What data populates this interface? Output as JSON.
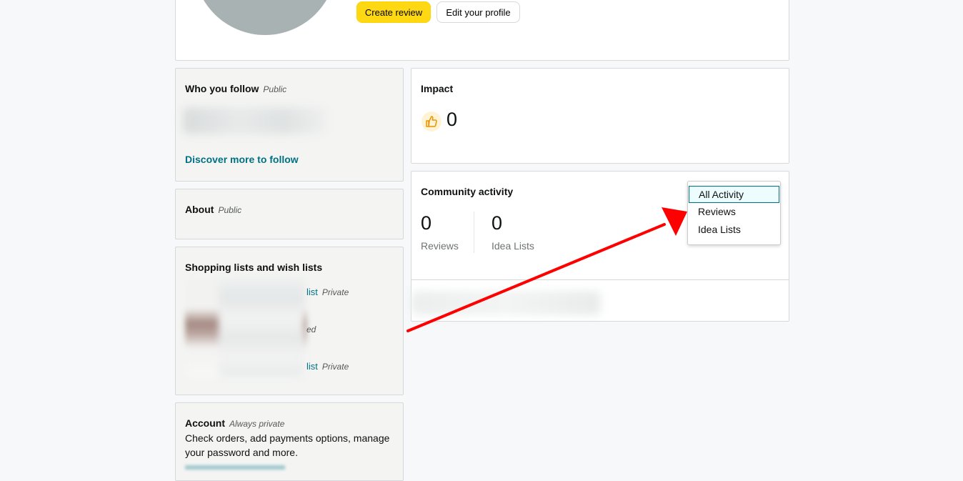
{
  "header": {
    "create_review_label": "Create review",
    "edit_profile_label": "Edit your profile"
  },
  "follow": {
    "title": "Who you follow",
    "visibility": "Public",
    "discover_link": "Discover more to follow"
  },
  "about": {
    "title": "About",
    "visibility": "Public"
  },
  "lists": {
    "title": "Shopping lists and wish lists",
    "rows": [
      {
        "link_fragment": "list",
        "visibility": "Private"
      },
      {
        "link_fragment": "",
        "visibility": "ed"
      },
      {
        "link_fragment": "list",
        "visibility": "Private"
      }
    ]
  },
  "account": {
    "title": "Account",
    "visibility": "Always private",
    "description": "Check orders, add payments options, manage your password and more."
  },
  "impact": {
    "title": "Impact",
    "count": "0"
  },
  "community": {
    "title": "Community activity",
    "reviews_count": "0",
    "reviews_label": "Reviews",
    "idea_lists_count": "0",
    "idea_lists_label": "Idea Lists"
  },
  "activity_filter": {
    "options": [
      "All Activity",
      "Reviews",
      "Idea Lists"
    ],
    "selected": "All Activity"
  },
  "colors": {
    "accent_link": "#007185",
    "primary_button": "#ffd814",
    "annotation_arrow": "#ff0000"
  }
}
